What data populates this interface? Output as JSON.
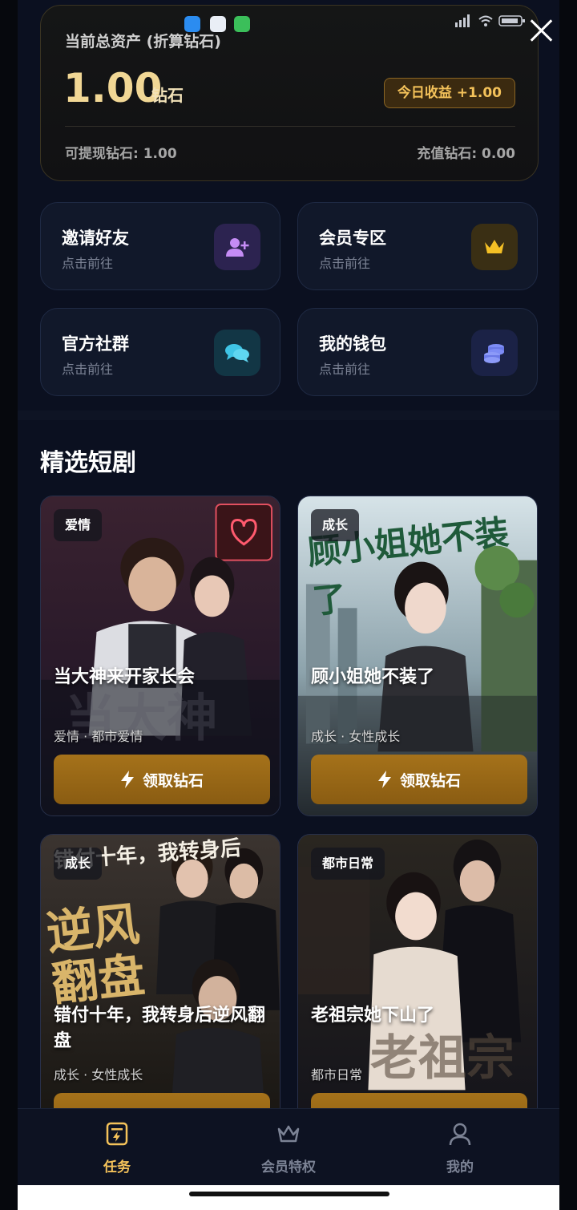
{
  "status_bar": {
    "time": "",
    "icons": [
      "signal-icon",
      "wifi-icon",
      "battery-icon"
    ]
  },
  "asset": {
    "title": "当前总资产 (折算钻石)",
    "amount": "1.00",
    "unit": "钻石",
    "today_badge": "今日收益 +1.00",
    "withdrawable": "可提现钻石: 1.00",
    "recharge": "充值钻石: 0.00"
  },
  "features": [
    {
      "title": "邀请好友",
      "sub": "点击前往",
      "icon": "add-user-icon"
    },
    {
      "title": "会员专区",
      "sub": "点击前往",
      "icon": "crown-icon"
    },
    {
      "title": "官方社群",
      "sub": "点击前往",
      "icon": "chat-icon"
    },
    {
      "title": "我的钱包",
      "sub": "点击前往",
      "icon": "coins-icon"
    }
  ],
  "section_title": "精选短剧",
  "dramas": [
    {
      "tag": "爱情",
      "name": "当大神来开家长会",
      "meta": "爱情 · 都市爱情",
      "button": "领取钻石"
    },
    {
      "tag": "成长",
      "name": "顾小姐她不装了",
      "meta": "成长 · 女性成长",
      "button": "领取钻石",
      "poster_text": "顾小姐她不装了"
    },
    {
      "tag": "成长",
      "name": "错付十年，我转身后逆风翻盘",
      "meta": "成长 · 女性成长",
      "poster_text_top": "错付十年，我转身后",
      "poster_text_big": "逆风翻盘"
    },
    {
      "tag": "都市日常",
      "name": "老祖宗她下山了",
      "meta": "都市日常",
      "poster_text": "老祖宗"
    }
  ],
  "tabs": [
    {
      "label": "任务",
      "icon": "task-icon",
      "active": true
    },
    {
      "label": "会员特权",
      "icon": "crown-outline-icon",
      "active": false
    },
    {
      "label": "我的",
      "icon": "person-icon",
      "active": false
    }
  ],
  "colors": {
    "gold": "#f1d795",
    "accent_button": "#a5721a",
    "active_tab": "#f4c25a",
    "inactive_tab": "#7c8395"
  }
}
